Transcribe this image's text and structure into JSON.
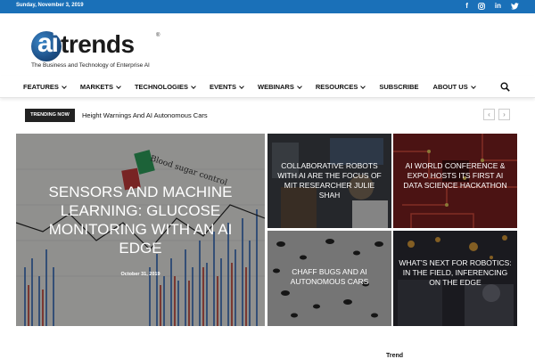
{
  "topbar": {
    "date": "Sunday, November 3, 2019",
    "social": [
      "facebook-icon",
      "instagram-icon",
      "linkedin-icon",
      "twitter-icon"
    ],
    "color": "#1a70b8"
  },
  "logo": {
    "ai": "ai",
    "trends": "trends",
    "reg": "®",
    "tagline": "The Business and Technology of Enterprise AI"
  },
  "nav": {
    "items": [
      {
        "label": "FEATURES",
        "has_dropdown": true
      },
      {
        "label": "MARKETS",
        "has_dropdown": true
      },
      {
        "label": "TECHNOLOGIES",
        "has_dropdown": true
      },
      {
        "label": "EVENTS",
        "has_dropdown": true
      },
      {
        "label": "WEBINARS",
        "has_dropdown": true
      },
      {
        "label": "RESOURCES",
        "has_dropdown": true
      },
      {
        "label": "SUBSCRIBE",
        "has_dropdown": false
      },
      {
        "label": "ABOUT US",
        "has_dropdown": true
      }
    ],
    "search_icon": "search-icon"
  },
  "trending": {
    "label": "TRENDING NOW",
    "headline": "Height Warnings And AI Autonomous Cars",
    "prev_icon": "‹",
    "next_icon": "›"
  },
  "featured": {
    "main": {
      "title": "Sensors and Machine Learning: Glucose Monitoring With an AI Edge",
      "date": "October 31, 2019"
    },
    "tiles": [
      {
        "title": "Collaborative Robots with AI are the Focus of MIT Researcher Julie Shah"
      },
      {
        "title": "AI World Conference & Expo Hosts Its First AI Data Science Hackathon"
      },
      {
        "title": "Chaff Bugs and AI Autonomous Cars"
      },
      {
        "title": "What’s Next for Robotics: In the Field, Inferencing on the Edge"
      }
    ]
  },
  "footer_stub": "Trend"
}
